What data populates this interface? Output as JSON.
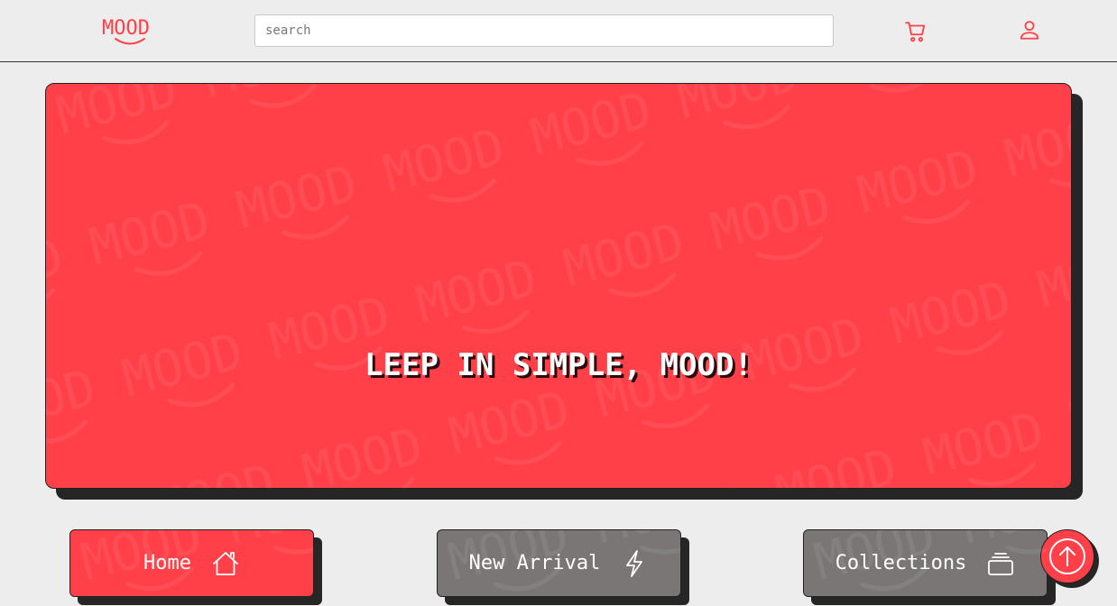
{
  "header": {
    "logo_text": "MOOD",
    "search_placeholder": "search",
    "cart_icon": "cart-icon",
    "user_icon": "user-icon"
  },
  "hero": {
    "title": "LEEP IN SIMPLE, MOOD!",
    "pattern_text": "MOOD"
  },
  "nav": [
    {
      "label": "Home",
      "icon": "home-icon"
    },
    {
      "label": "New Arrival",
      "icon": "lightning-icon"
    },
    {
      "label": "Collections",
      "icon": "collections-icon"
    }
  ],
  "scroll_top": {
    "icon": "arrow-up-circle-icon"
  },
  "colors": {
    "accent": "#ff4048",
    "shadow": "#262626",
    "background": "#ededed",
    "muted_button": "#7a7676"
  }
}
